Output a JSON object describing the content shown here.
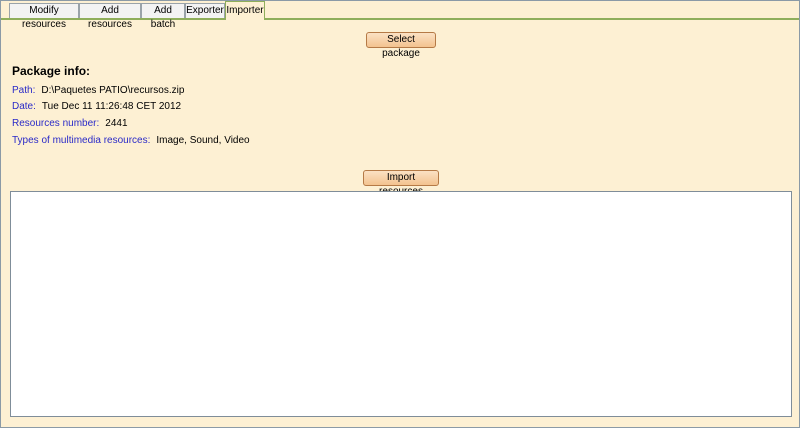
{
  "tabs": [
    {
      "label": "Modify resources"
    },
    {
      "label": "Add resources"
    },
    {
      "label": "Add batch"
    },
    {
      "label": "Exporter"
    },
    {
      "label": "Importer"
    }
  ],
  "active_tab": "Importer",
  "select_package_label": "Select package",
  "package_info": {
    "title": "Package info:",
    "path_label": "Path:",
    "path_value": "D:\\Paquetes PATIO\\recursos.zip",
    "date_label": "Date:",
    "date_value": "Tue Dec 11 11:26:48 CET 2012",
    "resources_label": "Resources number:",
    "resources_value": "2441",
    "types_label": "Types of multimedia resources:",
    "types_value": "Image, Sound, Video"
  },
  "import_resources_label": "Import resources",
  "colors": {
    "background": "#fdf0d3",
    "label_blue": "#2a2ac8",
    "button": "#f3c38f",
    "tab_border_active": "#8fae5b"
  }
}
